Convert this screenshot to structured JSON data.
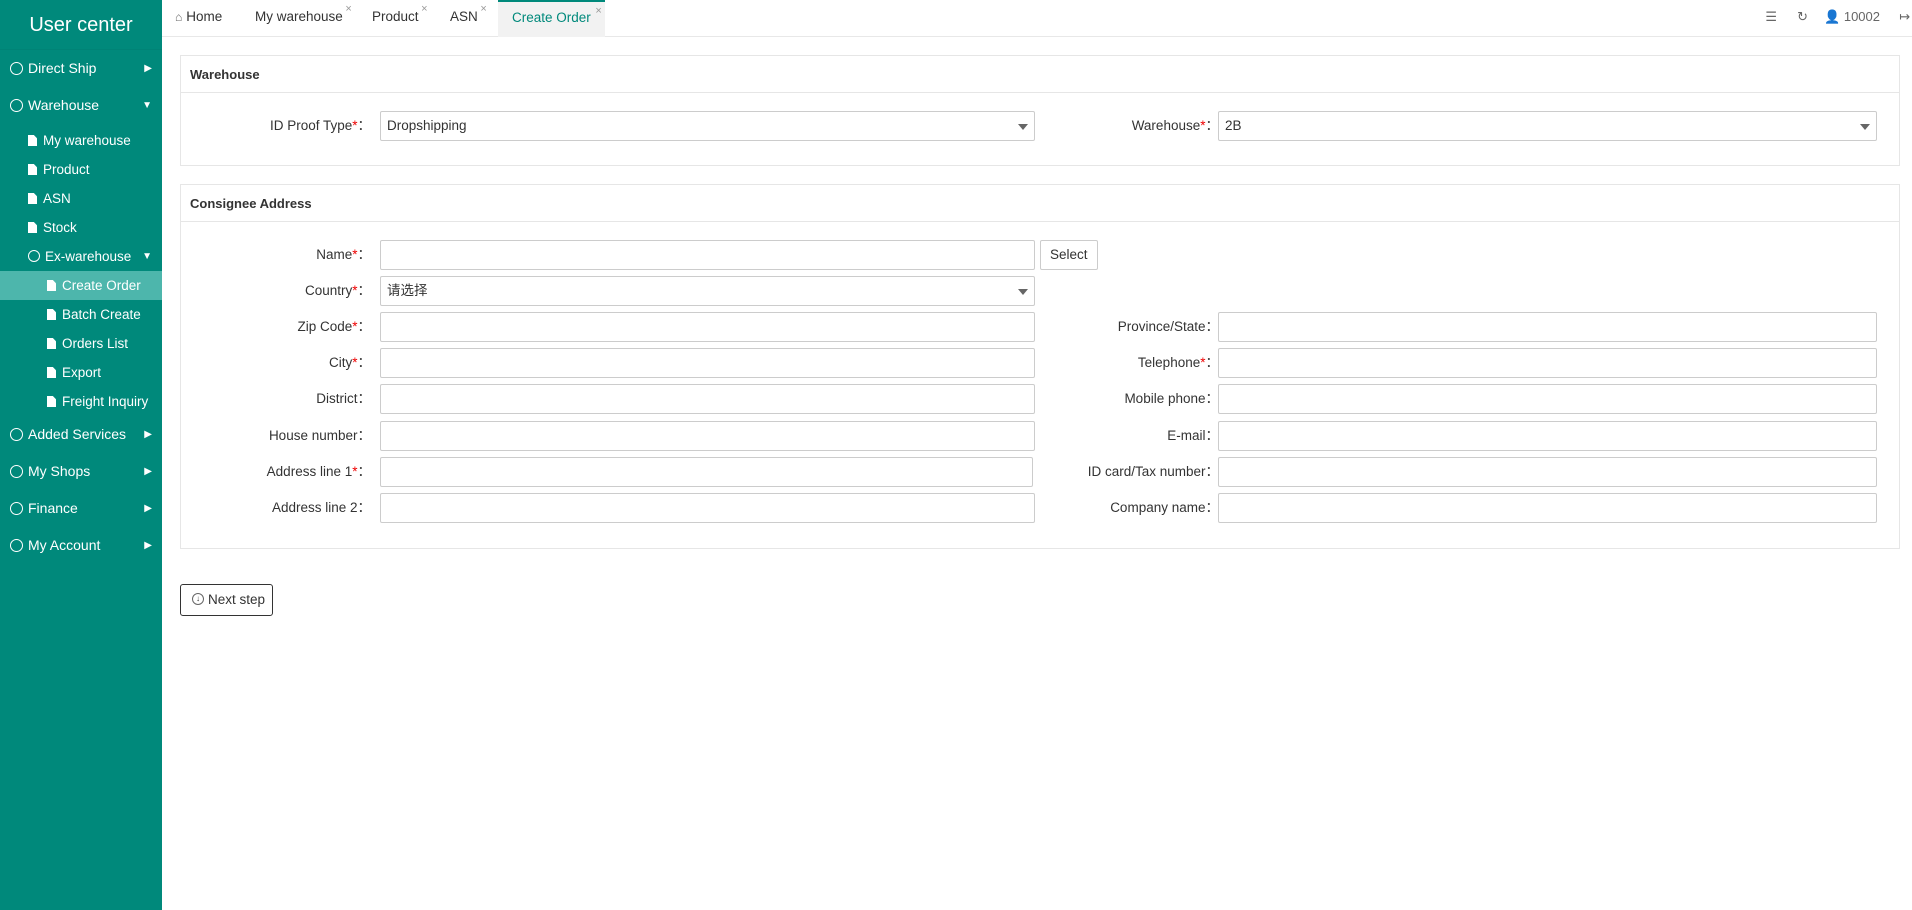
{
  "sidebar": {
    "title": "User center",
    "items": [
      {
        "label": "Direct Ship",
        "arrow": "▶"
      },
      {
        "label": "Warehouse",
        "arrow": "▼"
      },
      {
        "label": "Added Services",
        "arrow": "▶"
      },
      {
        "label": "My Shops",
        "arrow": "▶"
      },
      {
        "label": "Finance",
        "arrow": "▶"
      },
      {
        "label": "My Account",
        "arrow": "▶"
      }
    ],
    "warehouse_children": [
      "My warehouse",
      "Product",
      "ASN",
      "Stock"
    ],
    "ex_warehouse": {
      "label": "Ex-warehouse",
      "arrow": "▼"
    },
    "ex_children": [
      "Create Order",
      "Batch Create",
      "Orders List",
      "Export",
      "Freight Inquiry"
    ]
  },
  "tabs": {
    "home": "Home",
    "my_warehouse": "My warehouse",
    "product": "Product",
    "asn": "ASN",
    "create_order": "Create Order",
    "close_glyph": "×"
  },
  "topright": {
    "user": "10002"
  },
  "warehouse_panel": {
    "title": "Warehouse",
    "id_proof_label": "ID Proof Type",
    "id_proof_value": "Dropshipping",
    "warehouse_label": "Warehouse",
    "warehouse_value": "2B"
  },
  "consignee_panel": {
    "title": "Consignee Address",
    "name_label": "Name",
    "select_button": "Select",
    "country_label": "Country",
    "country_value": "请选择",
    "zip_label": "Zip Code",
    "province_label": "Province/State",
    "city_label": "City",
    "telephone_label": "Telephone",
    "district_label": "District",
    "mobile_label": "Mobile phone",
    "house_label": "House number",
    "email_label": "E-mail",
    "address1_label": "Address line 1",
    "idcard_label": "ID card/Tax number",
    "address2_label": "Address line 2",
    "company_label": "Company name"
  },
  "common": {
    "required_mark": "*",
    "colon": "："
  },
  "actions": {
    "next_step": "Next step"
  },
  "colors": {
    "sidebar_bg": "#00897b",
    "active_item": "#4db6ac",
    "accent": "#00897b",
    "required": "#ee0000"
  }
}
